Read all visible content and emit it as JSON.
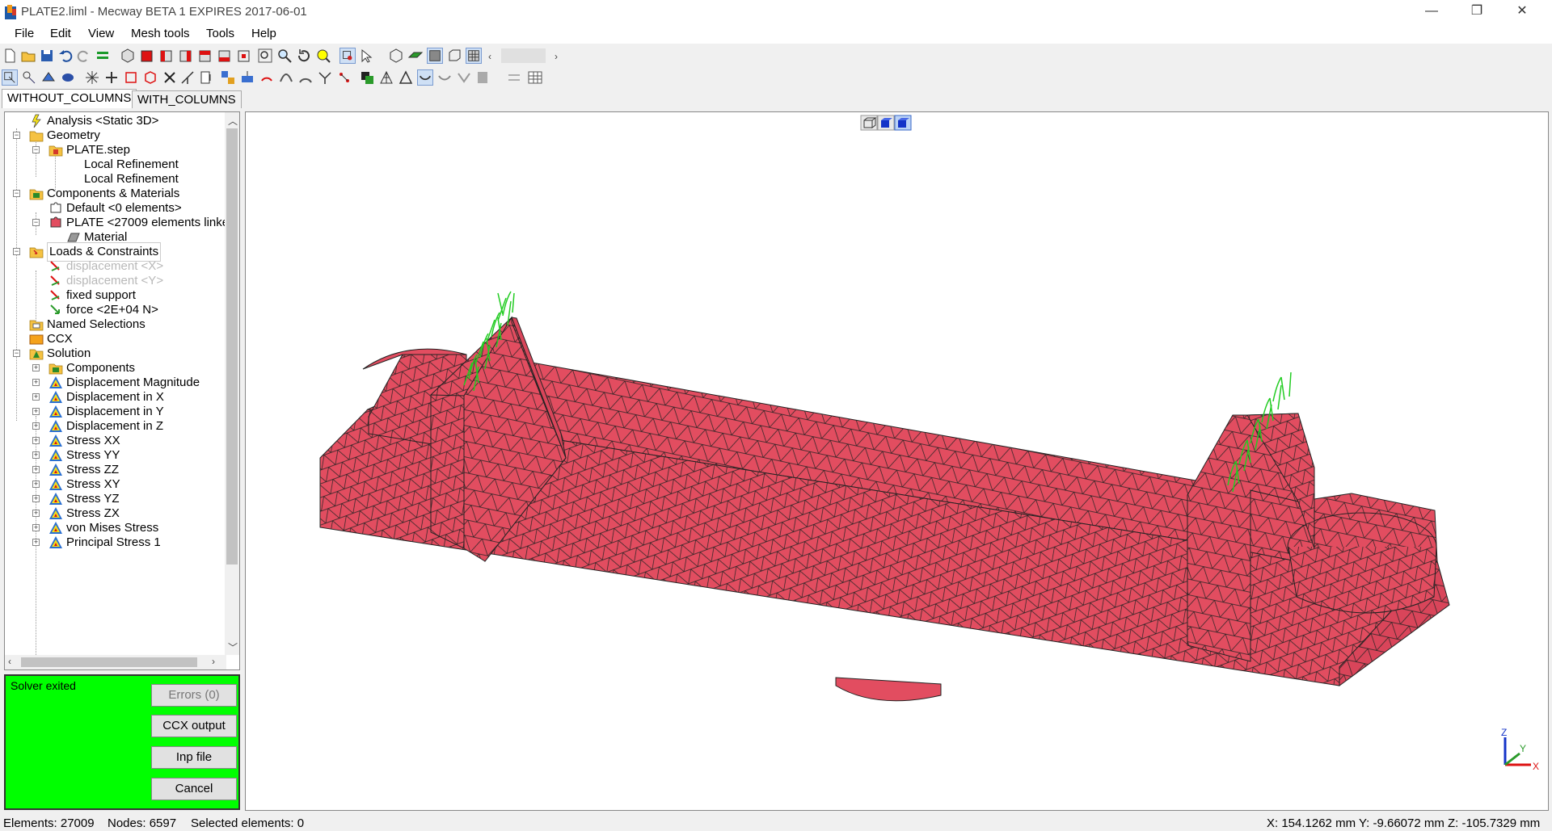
{
  "window": {
    "title": "PLATE2.liml - Mecway BETA 1 EXPIRES 2017-06-01"
  },
  "menu": {
    "file": "File",
    "edit": "Edit",
    "view": "View",
    "mesh_tools": "Mesh tools",
    "tools": "Tools",
    "help": "Help"
  },
  "tabs": {
    "without_columns": "WITHOUT_COLUMNS",
    "with_columns": "WITH_COLUMNS"
  },
  "tree": {
    "analysis": "Analysis <Static 3D>",
    "geometry": "Geometry",
    "plate_step": "PLATE.step",
    "local_ref_1": "Local Refinement",
    "local_ref_2": "Local Refinement",
    "components_materials": "Components & Materials",
    "default_comp": "Default <0 elements>",
    "plate_comp": "PLATE <27009 elements linke",
    "material": "Material",
    "loads_constraints": "Loads & Constraints",
    "disp_x": "displacement <X>",
    "disp_y": "displacement <Y>",
    "fixed_support": "fixed support",
    "force": "force <2E+04 N>",
    "named_selections": "Named Selections",
    "ccx": "CCX",
    "solution": "Solution",
    "sol_components": "Components",
    "disp_mag": "Displacement Magnitude",
    "disp_in_x": "Displacement in X",
    "disp_in_y": "Displacement in Y",
    "disp_in_z": "Displacement in Z",
    "stress_xx": "Stress XX",
    "stress_yy": "Stress YY",
    "stress_zz": "Stress ZZ",
    "stress_xy": "Stress XY",
    "stress_yz": "Stress YZ",
    "stress_zx": "Stress ZX",
    "von_mises": "von Mises Stress",
    "principal_1": "Principal Stress 1"
  },
  "solver": {
    "status": "Solver exited",
    "errors_btn": "Errors (0)",
    "ccx_output_btn": "CCX output",
    "inp_file_btn": "Inp file",
    "cancel_btn": "Cancel",
    "bg_color": "#00ff00"
  },
  "model": {
    "mesh_color": "#e24d60",
    "load_arrow_color": "#22cc22"
  },
  "axes": {
    "x": "X",
    "y": "Y",
    "z": "Z"
  },
  "status": {
    "elements": "Elements: 27009",
    "nodes": "Nodes: 6597",
    "selected": "Selected elements: 0",
    "coords": "X: 154.1262 mm Y: -9.66072 mm Z: -105.7329 mm"
  }
}
